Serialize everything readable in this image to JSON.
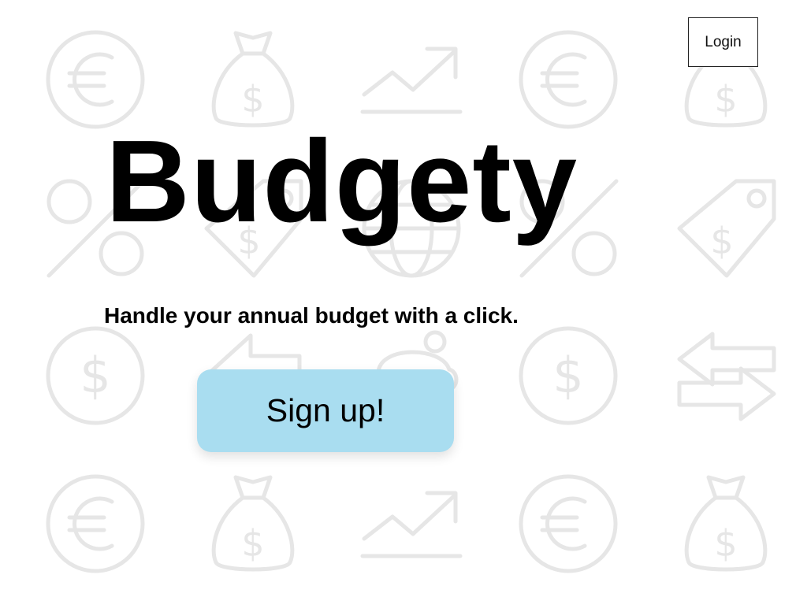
{
  "header": {
    "login_label": "Login"
  },
  "hero": {
    "title": "Budgety",
    "tagline": "Handle your annual budget with a click.",
    "signup_label": "Sign up!"
  },
  "background": {
    "pattern_color": "#e6e6e6",
    "icons": [
      "euro-coin-icon",
      "money-bag-icon",
      "trend-up-icon",
      "euro-coin-icon",
      "money-bag-icon",
      "percent-icon",
      "price-tag-icon",
      "globe-icon",
      "percent-icon",
      "price-tag-icon",
      "dollar-coin-icon",
      "arrow-left-icon",
      "piggy-bank-icon",
      "dollar-coin-icon",
      "exchange-arrows-icon",
      "euro-coin-icon",
      "money-bag-icon",
      "trend-up-icon",
      "euro-coin-icon",
      "money-bag-icon"
    ]
  },
  "colors": {
    "signup_button": "#a9ddf0",
    "background": "#ffffff",
    "text": "#000000"
  }
}
